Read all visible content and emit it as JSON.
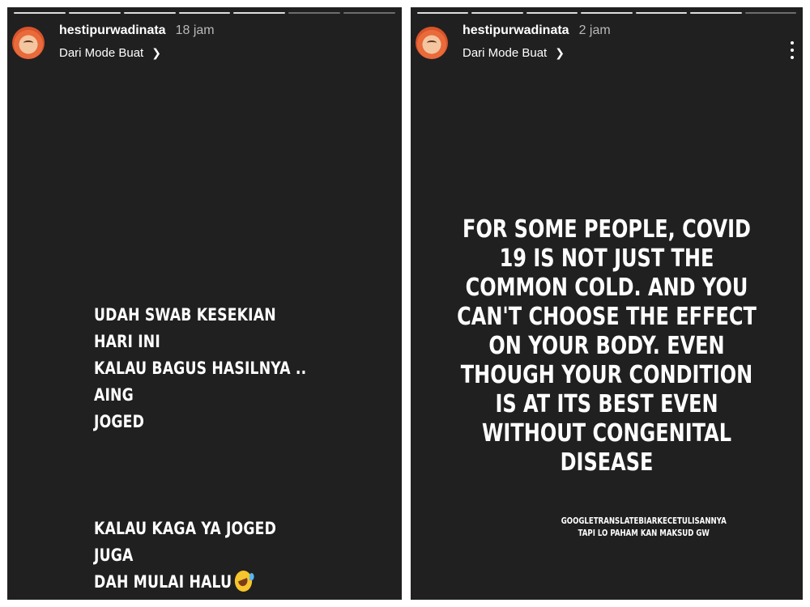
{
  "left_story": {
    "username": "hestipurwadinata",
    "time": "18 jam",
    "source_label": "Dari Mode Buat",
    "caption_line1": "Udah swab kesekian hari ini\nkalau bagus hasilnya .. aing\njoged",
    "caption_line2": "kalau kaga ya joged juga\ndah mulai halu",
    "emoji": "rolling-on-the-floor-laughing",
    "progress_segments": 7,
    "progress_completed": 5
  },
  "right_story": {
    "username": "hestipurwadinata",
    "time": "2 jam",
    "source_label": "Dari Mode Buat",
    "caption": "For some people, covid 19 is not just the common cold. And you can't choose the effect on your body. Even though your condition is at its best even without congenital disease",
    "note": "googletranslatebiarkecetulisannya\ntapi lo paham kan maksud gw",
    "progress_segments": 7,
    "progress_completed": 6
  },
  "colors": {
    "story_background": "#202020",
    "text": "#ffffff",
    "time_text": "#b8b8b8"
  }
}
